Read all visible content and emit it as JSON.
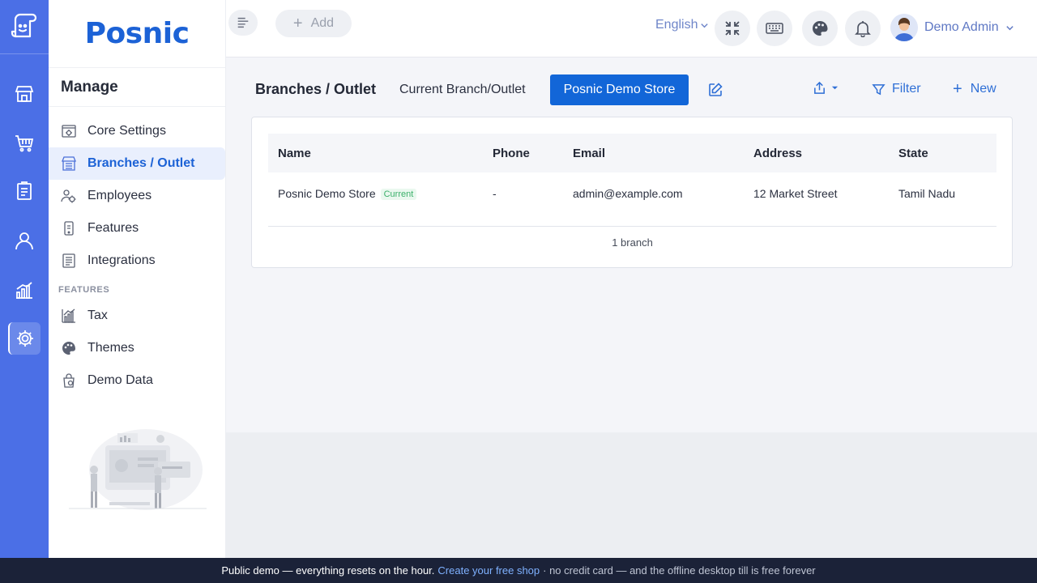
{
  "brand": {
    "name": "Posnic"
  },
  "rail": {
    "items": [
      {
        "icon": "store-icon"
      },
      {
        "icon": "cart-icon"
      },
      {
        "icon": "clipboard-icon"
      },
      {
        "icon": "user-icon"
      },
      {
        "icon": "bar-chart-icon"
      },
      {
        "icon": "gear-icon",
        "active": true
      }
    ]
  },
  "sidebar": {
    "heading": "Manage",
    "items": [
      {
        "label": "Core Settings",
        "icon": "settings-doc-icon"
      },
      {
        "label": "Branches / Outlet",
        "icon": "store-icon",
        "active": true
      },
      {
        "label": "Employees",
        "icon": "employees-icon"
      },
      {
        "label": "Features",
        "icon": "phone-icon"
      },
      {
        "label": "Integrations",
        "icon": "list-icon"
      }
    ],
    "section_label": "FEATURES",
    "feature_items": [
      {
        "label": "Tax",
        "icon": "chart-icon"
      },
      {
        "label": "Themes",
        "icon": "palette-icon"
      },
      {
        "label": "Demo Data",
        "icon": "bag-icon"
      }
    ]
  },
  "topbar": {
    "add_label": "Add",
    "language": "English",
    "user_name": "Demo Admin"
  },
  "page": {
    "title": "Branches / Outlet",
    "current_label": "Current Branch/Outlet",
    "current_store": "Posnic Demo Store",
    "filter_label": "Filter",
    "new_label": "New"
  },
  "table": {
    "columns": [
      "Name",
      "Phone",
      "Email",
      "Address",
      "State"
    ],
    "rows": [
      {
        "name": "Posnic Demo Store",
        "badge": "Current",
        "phone": "-",
        "email": "admin@example.com",
        "address": "12 Market Street",
        "state": "Tamil Nadu"
      }
    ],
    "footer": "1 branch"
  },
  "banner": {
    "text": "Public demo — everything resets on the hour.",
    "link": "Create your free shop",
    "rest": "· no credit card — and the offline desktop till is free forever"
  },
  "colors": {
    "rail": "#4b6fe6",
    "brand": "#1c62d6",
    "primary_button": "#1266d8",
    "banner": "#1b2238"
  }
}
